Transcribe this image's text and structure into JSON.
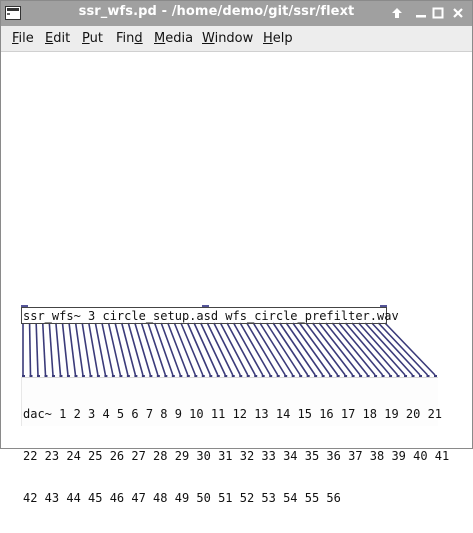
{
  "window": {
    "title": "ssr_wfs.pd  - /home/demo/git/ssr/flext",
    "buttons": {
      "up": "🡑",
      "minimize": "–",
      "maximize": "□",
      "close": "✕"
    }
  },
  "menu": {
    "items": [
      {
        "pre": "",
        "u": "F",
        "post": "ile"
      },
      {
        "pre": "",
        "u": "E",
        "post": "dit"
      },
      {
        "pre": "",
        "u": "P",
        "post": "ut"
      },
      {
        "pre": "Fin",
        "u": "d",
        "post": ""
      },
      {
        "pre": "",
        "u": "M",
        "post": "edia"
      },
      {
        "pre": "",
        "u": "W",
        "post": "indow"
      },
      {
        "pre": "",
        "u": "H",
        "post": "elp"
      }
    ]
  },
  "patch": {
    "object1": "ssr_wfs~ 3 circle_setup.asd wfs_circle_prefilter.wav",
    "object2_line1": "dac~ 1 2 3 4 5 6 7 8 9 10 11 12 13 14 15 16 17 18 19 20 21",
    "object2_line2": "22 23 24 25 26 27 28 29 30 31 32 33 34 35 36 37 38 39 40 41",
    "object2_line3": "42 43 44 45 46 47 48 49 50 51 52 53 54 55 56"
  },
  "colors": {
    "titlebar": "#a0a0a0",
    "wire": "#3b3b7a",
    "inlet": "#555599"
  }
}
